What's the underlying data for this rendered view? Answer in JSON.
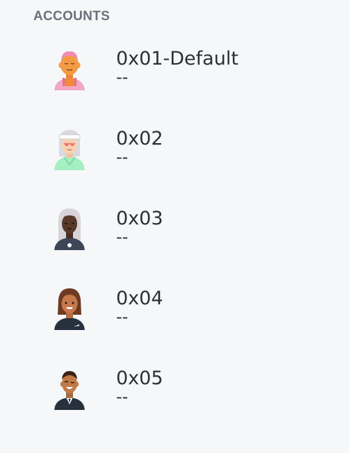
{
  "section": {
    "title": "ACCOUNTS"
  },
  "accounts": [
    {
      "name": "0x01-Default",
      "balance": "--",
      "avatar": "avatar-pink-hair-icon"
    },
    {
      "name": "0x02",
      "balance": "--",
      "avatar": "avatar-white-hair-visor-icon"
    },
    {
      "name": "0x03",
      "balance": "--",
      "avatar": "avatar-long-white-hair-icon"
    },
    {
      "name": "0x04",
      "balance": "--",
      "avatar": "avatar-brown-bob-hair-icon"
    },
    {
      "name": "0x05",
      "balance": "--",
      "avatar": "avatar-short-hair-suit-icon"
    }
  ],
  "colors": {
    "background": "#f5f7f9",
    "section_title": "#6b717b",
    "text": "#2c2f36"
  }
}
